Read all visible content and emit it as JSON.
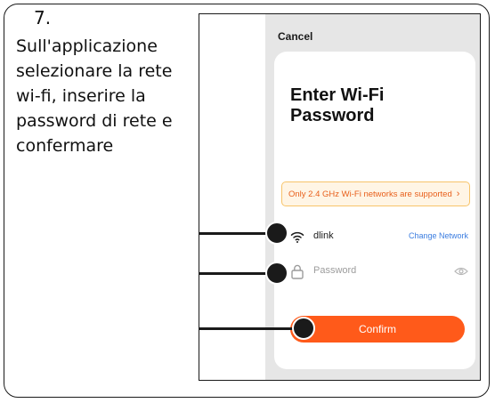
{
  "step": {
    "number": "7.",
    "instruction": "Sull'applicazione selezionare la rete wi-fi, inserire la password di rete e confermare"
  },
  "app": {
    "cancel_label": "Cancel",
    "title": "Enter Wi-Fi Password",
    "notice": {
      "text": "Only 2.4 GHz Wi-Fi networks are supported",
      "chevron": "›"
    },
    "network": {
      "ssid": "dlink",
      "change_label": "Change Network",
      "icon": "wifi-icon"
    },
    "password": {
      "placeholder": "Password",
      "value": "",
      "lock_icon": "lock-icon",
      "visibility_icon": "eye-icon"
    },
    "confirm_label": "Confirm"
  },
  "colors": {
    "accent": "#ff5a1a",
    "notice_text": "#e8601c",
    "notice_bg": "#fff5e5",
    "link": "#3b7de0",
    "screen_bg": "#e6e6e6"
  }
}
